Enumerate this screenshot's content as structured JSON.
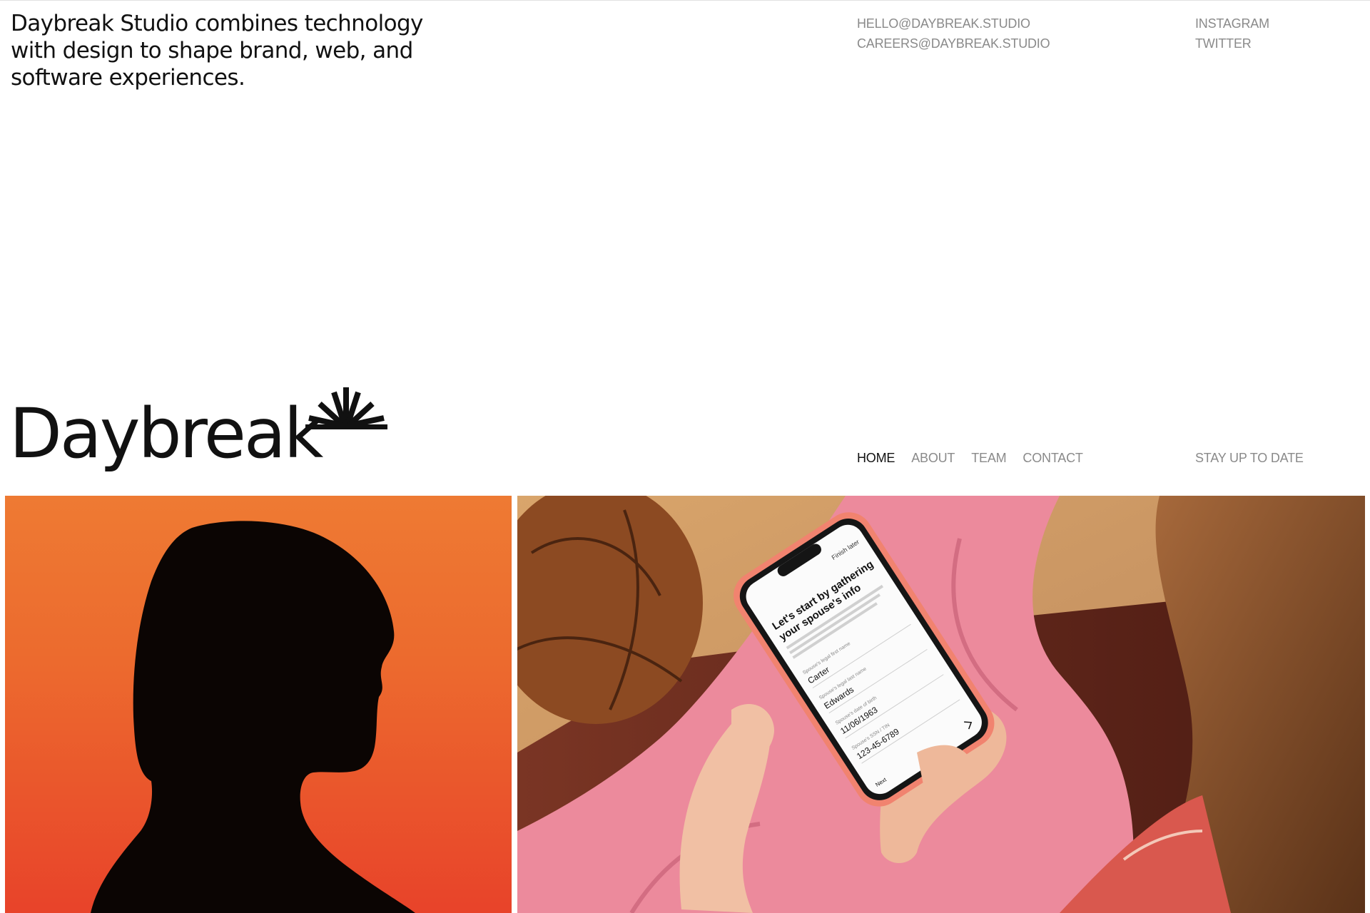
{
  "header": {
    "tagline_lines": [
      "Daybreak Studio combines technology",
      "with design to shape brand, web, and",
      "software experiences."
    ],
    "emails": [
      "HELLO@DAYBREAK.STUDIO",
      "CAREERS@DAYBREAK.STUDIO"
    ],
    "social": [
      "INSTAGRAM",
      "TWITTER"
    ]
  },
  "brand": {
    "wordmark": "Daybreak",
    "mark_icon": "sunburst-icon"
  },
  "nav": {
    "items": [
      "HOME",
      "ABOUT",
      "TEAM",
      "CONTACT"
    ],
    "active": "HOME",
    "newsletter": "STAY UP TO DATE"
  },
  "phone_screen": {
    "top_link": "Finish later",
    "heading_lines": [
      "Let's start by gathering",
      "your spouse's info"
    ],
    "fields": [
      {
        "label": "Spouse's legal first name",
        "value": "Carter"
      },
      {
        "label": "Spouse's legal last name",
        "value": "Edwards"
      },
      {
        "label": "Spouse's date of birth",
        "value": "11/06/1963"
      },
      {
        "label": "Spouse's SSN / TIN",
        "value": "123-45-6789"
      }
    ],
    "next_label": "Next"
  },
  "colors": {
    "text": "#111111",
    "muted": "#8a8a8a",
    "orange": "#ec6a2e",
    "red": "#e8432a",
    "pink": "#ec8a9c"
  }
}
